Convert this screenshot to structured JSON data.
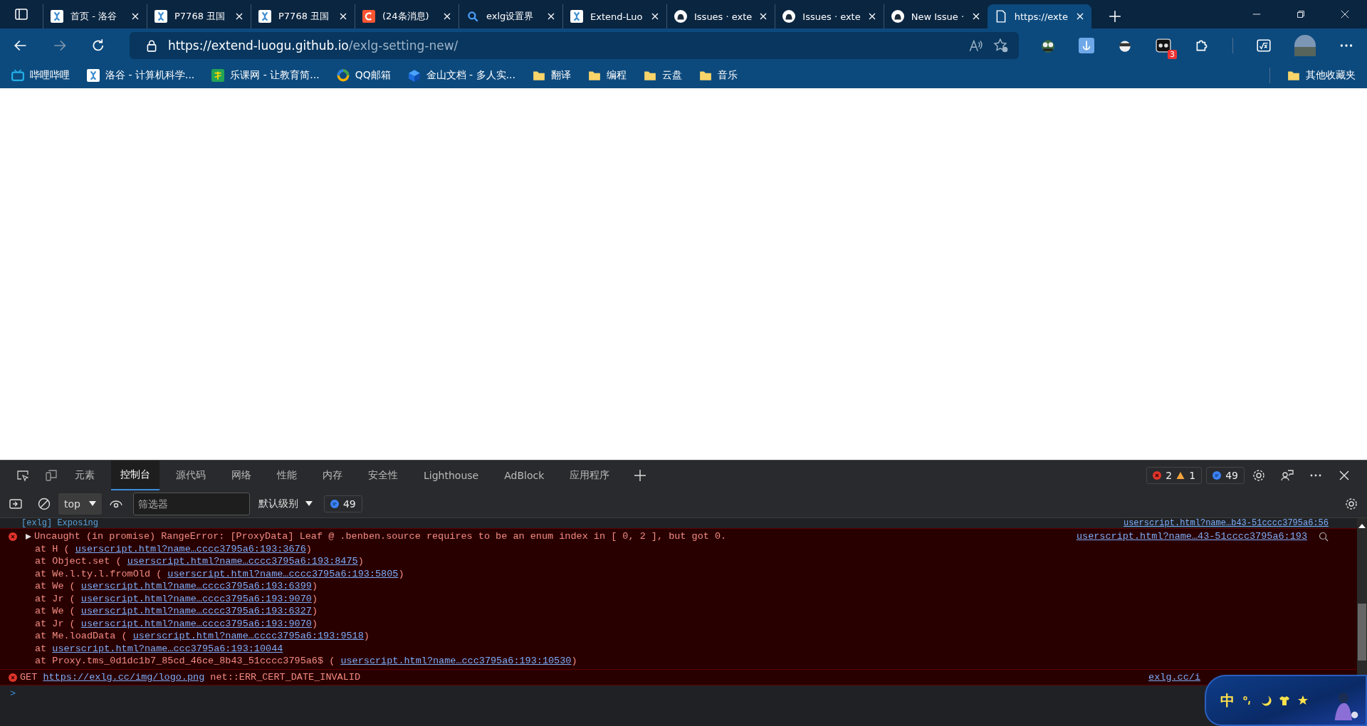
{
  "tabs": [
    {
      "title": "首页 - 洛谷",
      "kind": "luogu",
      "selected": false
    },
    {
      "title": "P7768 丑国",
      "kind": "luogu",
      "selected": false
    },
    {
      "title": "P7768 丑国",
      "kind": "luogu",
      "selected": false
    },
    {
      "title": "(24条消息)",
      "kind": "csdn",
      "selected": false
    },
    {
      "title": "exlg设置界",
      "kind": "search",
      "selected": false
    },
    {
      "title": "Extend-Luo",
      "kind": "luogu",
      "selected": false
    },
    {
      "title": "Issues · exte",
      "kind": "github",
      "selected": false
    },
    {
      "title": "Issues · exte",
      "kind": "github",
      "selected": false
    },
    {
      "title": "New Issue ·",
      "kind": "github",
      "selected": false
    },
    {
      "title": "https://exte",
      "kind": "page",
      "selected": true
    }
  ],
  "address_bar": {
    "host": "https://extend-luogu.github.io",
    "path": "/exlg-setting-new/"
  },
  "extensions": [
    {
      "kind": "goggles"
    },
    {
      "kind": "anchor"
    },
    {
      "kind": "ninja"
    },
    {
      "kind": "mask",
      "badge": "3"
    },
    {
      "kind": "puzzle"
    }
  ],
  "bookmarks": [
    {
      "label": "哔哩哔哩",
      "kind": "tv"
    },
    {
      "label": "洛谷 - 计算机科学...",
      "kind": "luogu"
    },
    {
      "label": "乐课网 - 让教育简...",
      "kind": "le"
    },
    {
      "label": "QQ邮箱",
      "kind": "ring"
    },
    {
      "label": "金山文档 - 多人实...",
      "kind": "cube"
    },
    {
      "label": "翻译",
      "kind": "folder"
    },
    {
      "label": "编程",
      "kind": "folder"
    },
    {
      "label": "云盘",
      "kind": "folder"
    },
    {
      "label": "音乐",
      "kind": "folder"
    }
  ],
  "other_bookmarks": "其他收藏夹",
  "devtools": {
    "tabs": [
      {
        "label": "元素",
        "selected": false
      },
      {
        "label": "控制台",
        "selected": true
      },
      {
        "label": "源代码",
        "selected": false
      },
      {
        "label": "网络",
        "selected": false
      },
      {
        "label": "性能",
        "selected": false
      },
      {
        "label": "内存",
        "selected": false
      },
      {
        "label": "安全性",
        "selected": false
      },
      {
        "label": "Lighthouse",
        "selected": false
      },
      {
        "label": "AdBlock",
        "selected": false
      },
      {
        "label": "应用程序",
        "selected": false
      }
    ],
    "error_count": "2",
    "warning_count": "1",
    "message_count": "49",
    "context": "top",
    "filter_placeholder": "筛选器",
    "level_menu": "默认级别",
    "toolbar_message_count": "49"
  },
  "console": {
    "partial": {
      "text": "[exlg] Exposing",
      "source": "userscript.html?name…b43-51cccc3795a6:56"
    },
    "error": {
      "message": "Uncaught (in promise) RangeError: [ProxyData] Leaf @ .benben.source requires to be an enum index in [ 0, 2 ], but got 0.",
      "expanded": false,
      "source": "userscript.html?name…43-51cccc3795a6:193",
      "frames": [
        {
          "before": "at H (",
          "link": "userscript.html?name…cccc3795a6:193:3676",
          "after": ")"
        },
        {
          "before": "at Object.set (",
          "link": "userscript.html?name…cccc3795a6:193:8475",
          "after": ")"
        },
        {
          "before": "at We.l.ty.l.fromOld (",
          "link": "userscript.html?name…cccc3795a6:193:5805",
          "after": ")"
        },
        {
          "before": "at We (",
          "link": "userscript.html?name…cccc3795a6:193:6399",
          "after": ")"
        },
        {
          "before": "at Jr (",
          "link": "userscript.html?name…cccc3795a6:193:9070",
          "after": ")"
        },
        {
          "before": "at We (",
          "link": "userscript.html?name…cccc3795a6:193:6327",
          "after": ")"
        },
        {
          "before": "at Jr (",
          "link": "userscript.html?name…cccc3795a6:193:9070",
          "after": ")"
        },
        {
          "before": "at Me.loadData (",
          "link": "userscript.html?name…cccc3795a6:193:9518",
          "after": ")"
        },
        {
          "before": "at",
          "link": "userscript.html?name…ccc3795a6:193:10044"
        },
        {
          "before": "at Proxy.tms_0d1dc1b7_85cd_46ce_8b43_51cccc3795a6$ (",
          "link": "userscript.html?name…ccc3795a6:193:10530",
          "after": ")"
        }
      ]
    },
    "network_error": {
      "method": "GET",
      "url": "https://exlg.cc/img/logo.png",
      "message": "net::ERR_CERT_DATE_INVALID",
      "source": "exlg.cc/i"
    },
    "prompt": ">"
  },
  "ime_toolbar": {
    "mode": "中"
  }
}
